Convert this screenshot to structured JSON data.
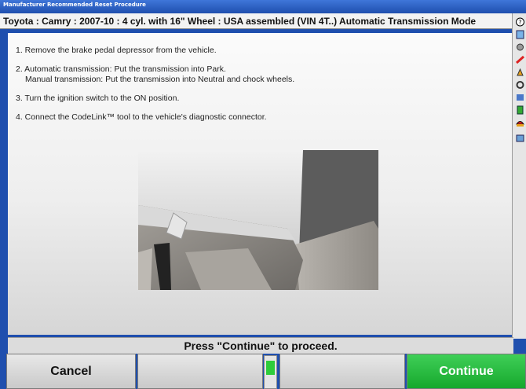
{
  "window": {
    "title": "Manufacturer Recommended Reset Procedure"
  },
  "vehicle": {
    "description": "Toyota : Camry : 2007-10 : 4 cyl. with 16\" Wheel : USA assembled (VIN 4T..) Automatic Transmission Mode"
  },
  "steps": [
    {
      "text": "1. Remove the brake pedal depressor from the vehicle."
    },
    {
      "line1": "2. Automatic transmission: Put the transmission into Park.",
      "line2": "Manual transmission: Put the transmission into Neutral and chock wheels."
    },
    {
      "text": "3. Turn the ignition switch to the ON position."
    },
    {
      "text": "4. Connect the CodeLink™ tool to the vehicle's diagnostic connector."
    }
  ],
  "status": {
    "message": "Press \"Continue\" to proceed."
  },
  "buttons": {
    "cancel": "Cancel",
    "blank2": "",
    "blank3": "",
    "continue": "Continue"
  },
  "colors": {
    "accent": "#1f4fae",
    "continue": "#1fb536",
    "meter": "#2ecc3a"
  },
  "side_tools": [
    "help-icon",
    "alignment-icon",
    "wheel-icon",
    "measure-icon",
    "caster-icon",
    "print-icon",
    "specs-icon",
    "camber-icon",
    "vehicle-icon",
    "tools-icon"
  ]
}
